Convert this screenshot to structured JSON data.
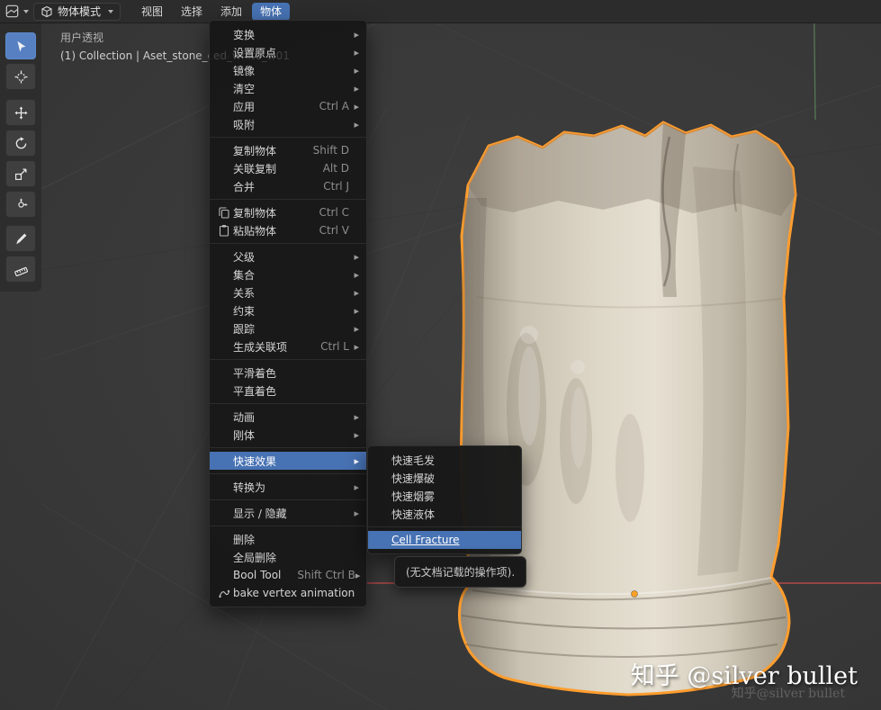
{
  "accent_color": "#4772b3",
  "header": {
    "mode_dropdown": {
      "label": "物体模式"
    },
    "menus": [
      {
        "id": "view",
        "label": "视图"
      },
      {
        "id": "select",
        "label": "选择"
      },
      {
        "id": "add",
        "label": "添加"
      },
      {
        "id": "object",
        "label": "物体",
        "active": true
      }
    ]
  },
  "toolbar": {
    "tools": [
      {
        "name": "select-box",
        "active": true
      },
      {
        "name": "cursor"
      },
      {
        "name": "move"
      },
      {
        "name": "rotate"
      },
      {
        "name": "scale"
      },
      {
        "name": "transform"
      },
      {
        "name": "annotate"
      },
      {
        "name": "measure"
      }
    ]
  },
  "viewport": {
    "perspective_label": "用户透视",
    "collection_path": "(1) Collection | Aset_stone_carv",
    "collection_path_dim": "ed_white_w01",
    "selection_outline_color": "#ff9d2e",
    "x_axis_color": "#c24b4b",
    "y_axis_color": "#6fae6f"
  },
  "object_menu": {
    "items": [
      {
        "name": "transform",
        "label": "变换",
        "submenu": true
      },
      {
        "name": "set-origin",
        "label": "设置原点",
        "submenu": true
      },
      {
        "name": "mirror",
        "label": "镜像",
        "submenu": true
      },
      {
        "name": "clear",
        "label": "清空",
        "submenu": true
      },
      {
        "name": "apply",
        "label": "应用",
        "shortcut": "Ctrl A",
        "submenu": true
      },
      {
        "name": "snap",
        "label": "吸附",
        "submenu": true
      },
      {
        "sep": true
      },
      {
        "name": "duplicate-objects",
        "label": "复制物体",
        "shortcut": "Shift D"
      },
      {
        "name": "duplicate-linked",
        "label": "关联复制",
        "shortcut": "Alt D"
      },
      {
        "name": "join",
        "label": "合并",
        "shortcut": "Ctrl J"
      },
      {
        "sep": true
      },
      {
        "name": "copy-objects",
        "label": "复制物体",
        "shortcut": "Ctrl C",
        "icon": "copy"
      },
      {
        "name": "paste-objects",
        "label": "粘贴物体",
        "shortcut": "Ctrl V",
        "icon": "paste"
      },
      {
        "sep": true
      },
      {
        "name": "parent",
        "label": "父级",
        "submenu": true
      },
      {
        "name": "collection",
        "label": "集合",
        "submenu": true
      },
      {
        "name": "relations",
        "label": "关系",
        "submenu": true
      },
      {
        "name": "constraints",
        "label": "约束",
        "submenu": true
      },
      {
        "name": "track",
        "label": "跟踪",
        "submenu": true
      },
      {
        "name": "make-links",
        "label": "生成关联项",
        "shortcut": "Ctrl L",
        "submenu": true
      },
      {
        "sep": true
      },
      {
        "name": "shade-smooth",
        "label": "平滑着色"
      },
      {
        "name": "shade-flat",
        "label": "平直着色"
      },
      {
        "sep": true
      },
      {
        "name": "animation",
        "label": "动画",
        "submenu": true
      },
      {
        "name": "rigid-body",
        "label": "刚体",
        "submenu": true
      },
      {
        "sep": true
      },
      {
        "name": "quick-effects",
        "label": "快速效果",
        "submenu": true,
        "hl": true
      },
      {
        "sep": true
      },
      {
        "name": "convert-to",
        "label": "转换为",
        "submenu": true
      },
      {
        "sep": true
      },
      {
        "name": "show-hide",
        "label": "显示 / 隐藏",
        "submenu": true
      },
      {
        "sep": true
      },
      {
        "name": "delete",
        "label": "删除"
      },
      {
        "name": "delete-global",
        "label": "全局删除"
      },
      {
        "name": "bool-tool",
        "label": "Bool Tool",
        "shortcut": "Shift Ctrl B",
        "submenu": true
      },
      {
        "name": "bake-vertex-animation",
        "label": "bake vertex animation",
        "icon": "bake"
      }
    ]
  },
  "quick_effects_submenu": {
    "items": [
      {
        "name": "quick-fur",
        "label": "快速毛发"
      },
      {
        "name": "quick-explode",
        "label": "快速爆破"
      },
      {
        "name": "quick-smoke",
        "label": "快速烟雾"
      },
      {
        "name": "quick-liquid",
        "label": "快速液体"
      },
      {
        "sep": true
      },
      {
        "name": "cell-fracture",
        "label": "Cell Fracture",
        "hl": true,
        "underline": true
      }
    ]
  },
  "tooltip": {
    "text": "(无文档记载的操作项)."
  },
  "watermark": {
    "text": "知乎 @silver bullet",
    "echo": "知乎@silver bullet"
  }
}
